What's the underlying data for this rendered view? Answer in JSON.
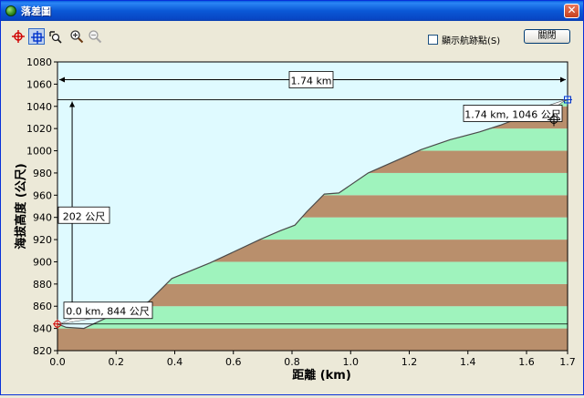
{
  "window": {
    "title": "落差圖",
    "close_glyph": "✕"
  },
  "toolbar": {
    "tools": [
      {
        "name": "crosshair-red-icon"
      },
      {
        "name": "crosshair-blue-icon"
      },
      {
        "name": "rotate-magnifier-icon"
      },
      {
        "name": "zoom-in-icon"
      },
      {
        "name": "zoom-out-icon"
      }
    ],
    "show_track_label": "顯示航跡點(S)",
    "show_track_checked": false,
    "close_label": "關閉"
  },
  "colors": {
    "sky": "#dffaff",
    "band_brown": "#b98f6c",
    "band_green": "#9ff3bd",
    "profile_line": "#4a4a4a",
    "accent_red": "#d00000",
    "accent_blue": "#0033cc"
  },
  "chart_data": {
    "type": "area",
    "xlabel": "距離 (km)",
    "ylabel": "海拔高度 (公尺)",
    "xlim": [
      0,
      1.74
    ],
    "ylim": [
      820,
      1080
    ],
    "x_ticks": [
      "0.0",
      "0.2",
      "0.4",
      "0.6",
      "0.8",
      "1.0",
      "1.2",
      "1.4",
      "1.6",
      "1.7"
    ],
    "y_ticks": [
      "820",
      "840",
      "860",
      "880",
      "900",
      "920",
      "940",
      "960",
      "980",
      "1000",
      "1020",
      "1040",
      "1060",
      "1080"
    ],
    "x_tick_values": [
      0,
      0.2,
      0.4,
      0.6,
      0.8,
      1.0,
      1.2,
      1.4,
      1.6,
      1.74
    ],
    "y_tick_values": [
      820,
      840,
      860,
      880,
      900,
      920,
      940,
      960,
      980,
      1000,
      1020,
      1040,
      1060,
      1080
    ],
    "x": [
      0.0,
      0.03,
      0.09,
      0.22,
      0.31,
      0.39,
      0.52,
      0.69,
      0.76,
      0.81,
      0.85,
      0.91,
      0.96,
      1.06,
      1.24,
      1.34,
      1.44,
      1.51,
      1.58,
      1.65,
      1.74
    ],
    "y": [
      844,
      841,
      840,
      856,
      864,
      885,
      899,
      920,
      928,
      933,
      945,
      961,
      962,
      980,
      1001,
      1010,
      1017,
      1023,
      1030,
      1037,
      1046
    ],
    "band_height": 20,
    "grid": false,
    "annotations": {
      "total_distance": "1.74 km",
      "elevation_gain": "202 公尺",
      "start_label": "0.0 km, 844 公尺",
      "end_label": "1.74 km, 1046 公尺"
    }
  }
}
